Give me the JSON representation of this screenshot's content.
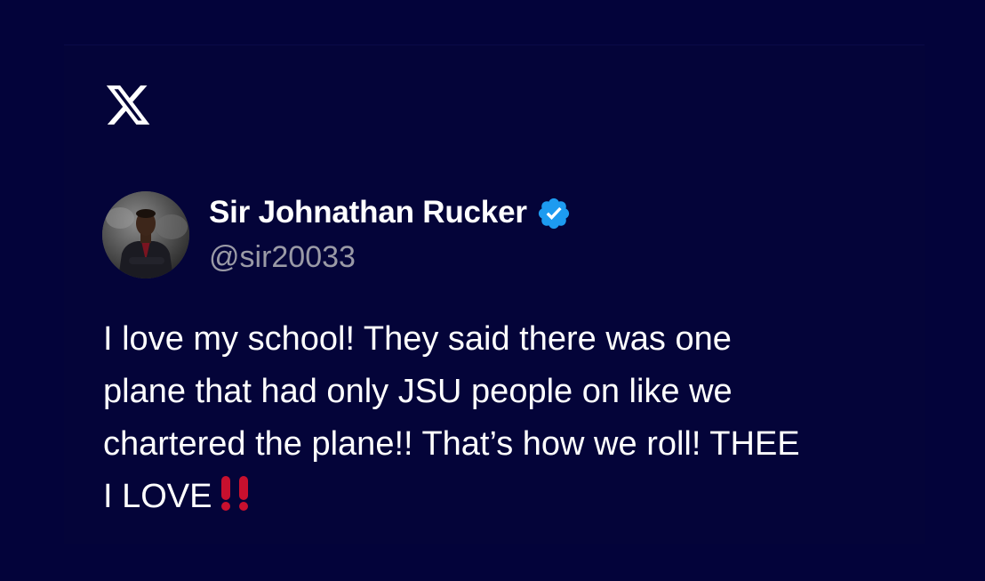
{
  "brand": {
    "logo_icon": "x-logo-icon"
  },
  "author": {
    "display_name": "Sir Johnathan Rucker",
    "handle": "@sir20033",
    "verified_icon": "verified-badge-icon",
    "verified_color": "#1d9bf0"
  },
  "tweet": {
    "lines": [
      "I love my school! They said there was one",
      "plane that had only JSU people on like we",
      "chartered the plane!! That’s how we roll! THEE",
      "I LOVE"
    ],
    "emoji": "‼️",
    "emoji_icon": "double-exclamation-icon",
    "emoji_color": "#c8102e"
  },
  "colors": {
    "background": "#03033a",
    "text": "#ffffff",
    "handle": "#9a9aa6"
  }
}
